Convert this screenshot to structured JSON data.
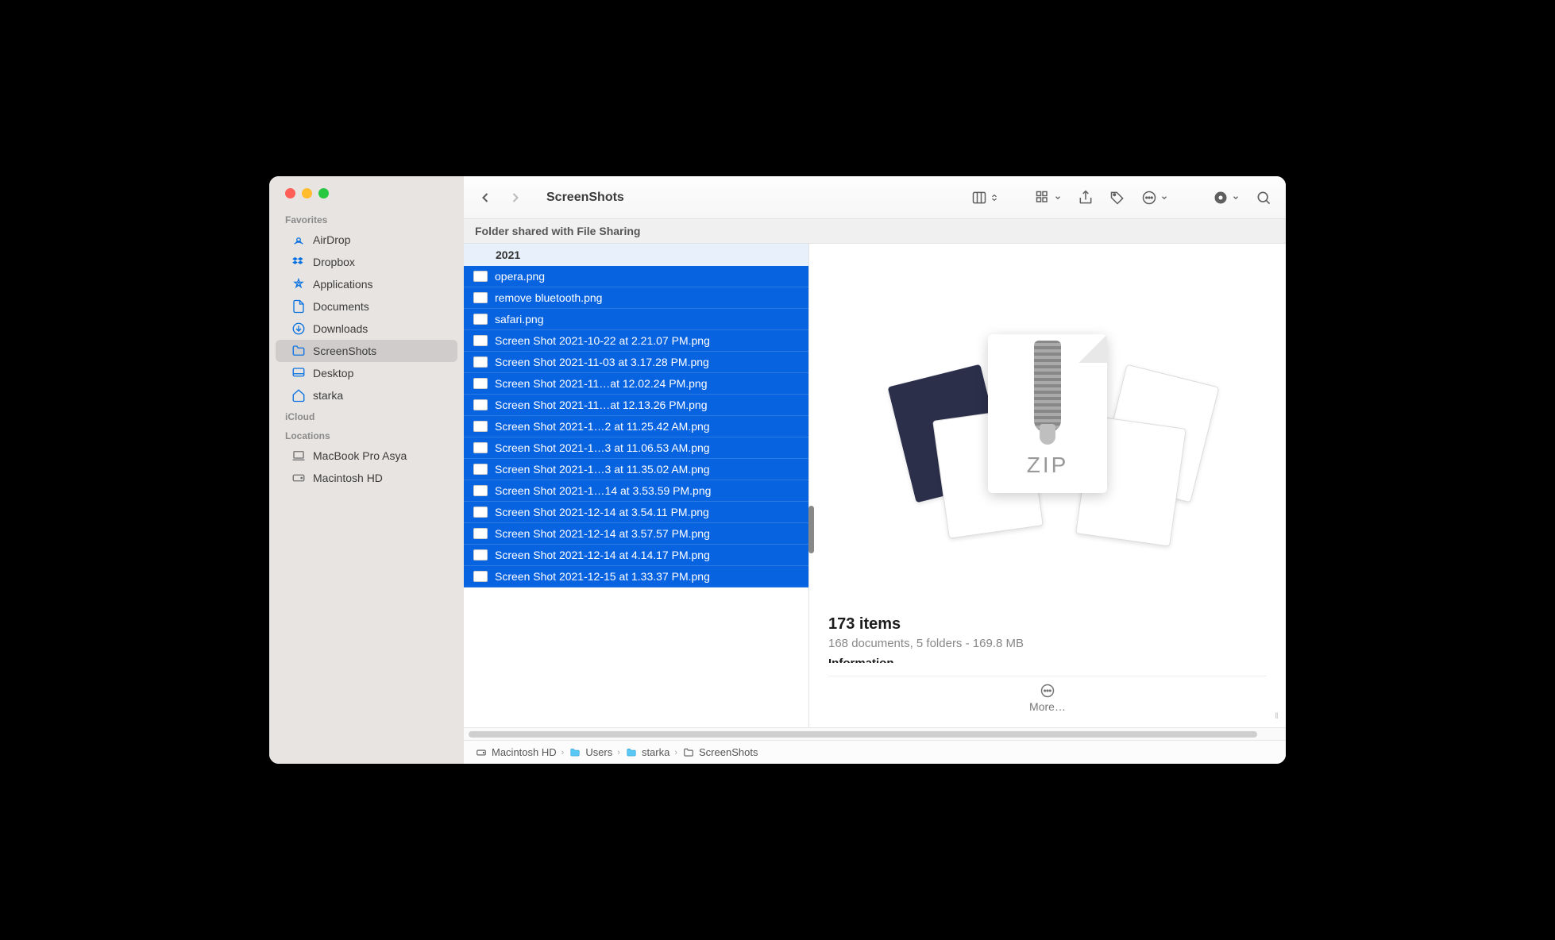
{
  "window": {
    "title": "ScreenShots"
  },
  "share_banner": "Folder shared with File Sharing",
  "sidebar": {
    "sections": [
      {
        "label": "Favorites",
        "items": [
          {
            "icon": "airdrop",
            "label": "AirDrop"
          },
          {
            "icon": "dropbox",
            "label": "Dropbox"
          },
          {
            "icon": "applications",
            "label": "Applications"
          },
          {
            "icon": "document",
            "label": "Documents"
          },
          {
            "icon": "download",
            "label": "Downloads"
          },
          {
            "icon": "folder",
            "label": "ScreenShots",
            "active": true
          },
          {
            "icon": "desktop",
            "label": "Desktop"
          },
          {
            "icon": "home",
            "label": "starka"
          }
        ]
      },
      {
        "label": "iCloud",
        "items": []
      },
      {
        "label": "Locations",
        "items": [
          {
            "icon": "laptop",
            "label": "MacBook Pro Asya",
            "gray": true
          },
          {
            "icon": "disk",
            "label": "Macintosh HD",
            "gray": true
          }
        ]
      }
    ]
  },
  "group_header": "2021",
  "files": [
    "opera.png",
    "remove bluetooth.png",
    "safari.png",
    "Screen Shot 2021-10-22 at 2.21.07 PM.png",
    "Screen Shot 2021-11-03 at 3.17.28 PM.png",
    "Screen Shot 2021-11…at 12.02.24 PM.png",
    "Screen Shot 2021-11…at 12.13.26 PM.png",
    "Screen Shot 2021-1…2 at 11.25.42 AM.png",
    "Screen Shot 2021-1…3 at 11.06.53 AM.png",
    "Screen Shot 2021-1…3 at 11.35.02 AM.png",
    "Screen Shot 2021-1…14 at 3.53.59 PM.png",
    "Screen Shot 2021-12-14 at 3.54.11 PM.png",
    "Screen Shot 2021-12-14 at 3.57.57 PM.png",
    "Screen Shot 2021-12-14 at 4.14.17 PM.png",
    "Screen Shot 2021-12-15 at 1.33.37 PM.png"
  ],
  "preview": {
    "zip_label": "ZIP",
    "item_count": "173 items",
    "sub": "168 documents, 5 folders - 169.8 MB",
    "more": "More…"
  },
  "pathbar": [
    {
      "icon": "disk",
      "label": "Macintosh HD"
    },
    {
      "icon": "folder-system",
      "label": "Users"
    },
    {
      "icon": "folder-system",
      "label": "starka"
    },
    {
      "icon": "folder",
      "label": "ScreenShots"
    }
  ]
}
